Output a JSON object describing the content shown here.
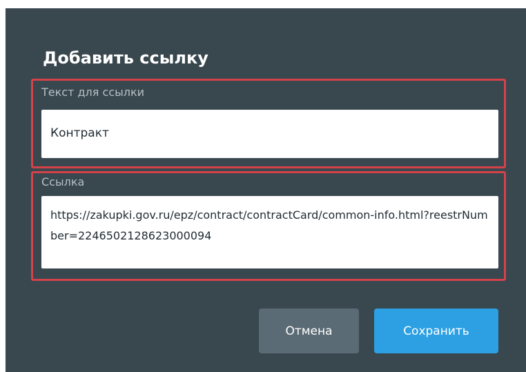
{
  "dialog": {
    "title": "Добавить ссылку",
    "link_text_field": {
      "label": "Текст для ссылки",
      "value": "Контракт"
    },
    "url_field": {
      "label": "Ссылка",
      "value": "https://zakupki.gov.ru/epz/contract/contractCard/common-info.html?reestrNumber=2246502128623000094"
    },
    "buttons": {
      "cancel_label": "Отмена",
      "save_label": "Сохранить"
    }
  },
  "colors": {
    "dialog_background": "#39474f",
    "highlight_border": "#d6424a",
    "cancel_button": "#5b6b75",
    "save_button": "#2ca0e3"
  }
}
